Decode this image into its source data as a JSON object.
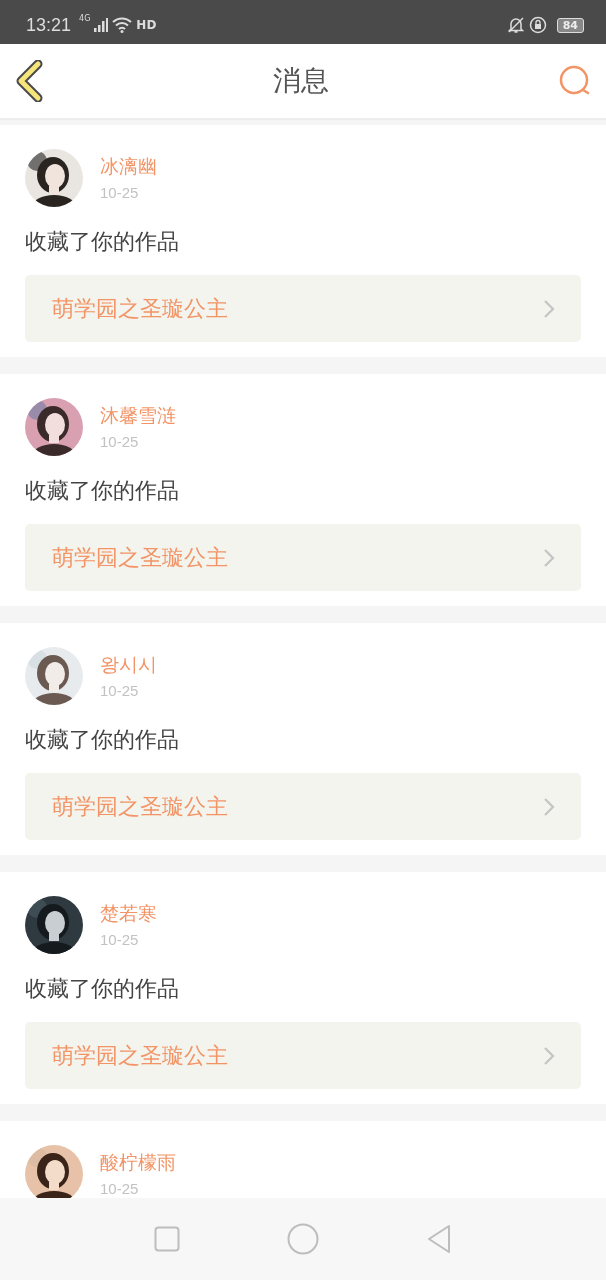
{
  "status_bar": {
    "time": "13:21",
    "network": "4G",
    "call": "HD",
    "battery": "84"
  },
  "header": {
    "title": "消息"
  },
  "messages": [
    {
      "user": "冰漓幽",
      "date": "10-25",
      "action": "收藏了你的作品",
      "work": "萌学园之圣璇公主"
    },
    {
      "user": "沐馨雪涟",
      "date": "10-25",
      "action": "收藏了你的作品",
      "work": "萌学园之圣璇公主"
    },
    {
      "user": "왕시시",
      "date": "10-25",
      "action": "收藏了你的作品",
      "work": "萌学园之圣璇公主"
    },
    {
      "user": "楚若寒",
      "date": "10-25",
      "action": "收藏了你的作品",
      "work": "萌学园之圣璇公主"
    },
    {
      "user": "酸柠檬雨",
      "date": "10-25"
    }
  ]
}
